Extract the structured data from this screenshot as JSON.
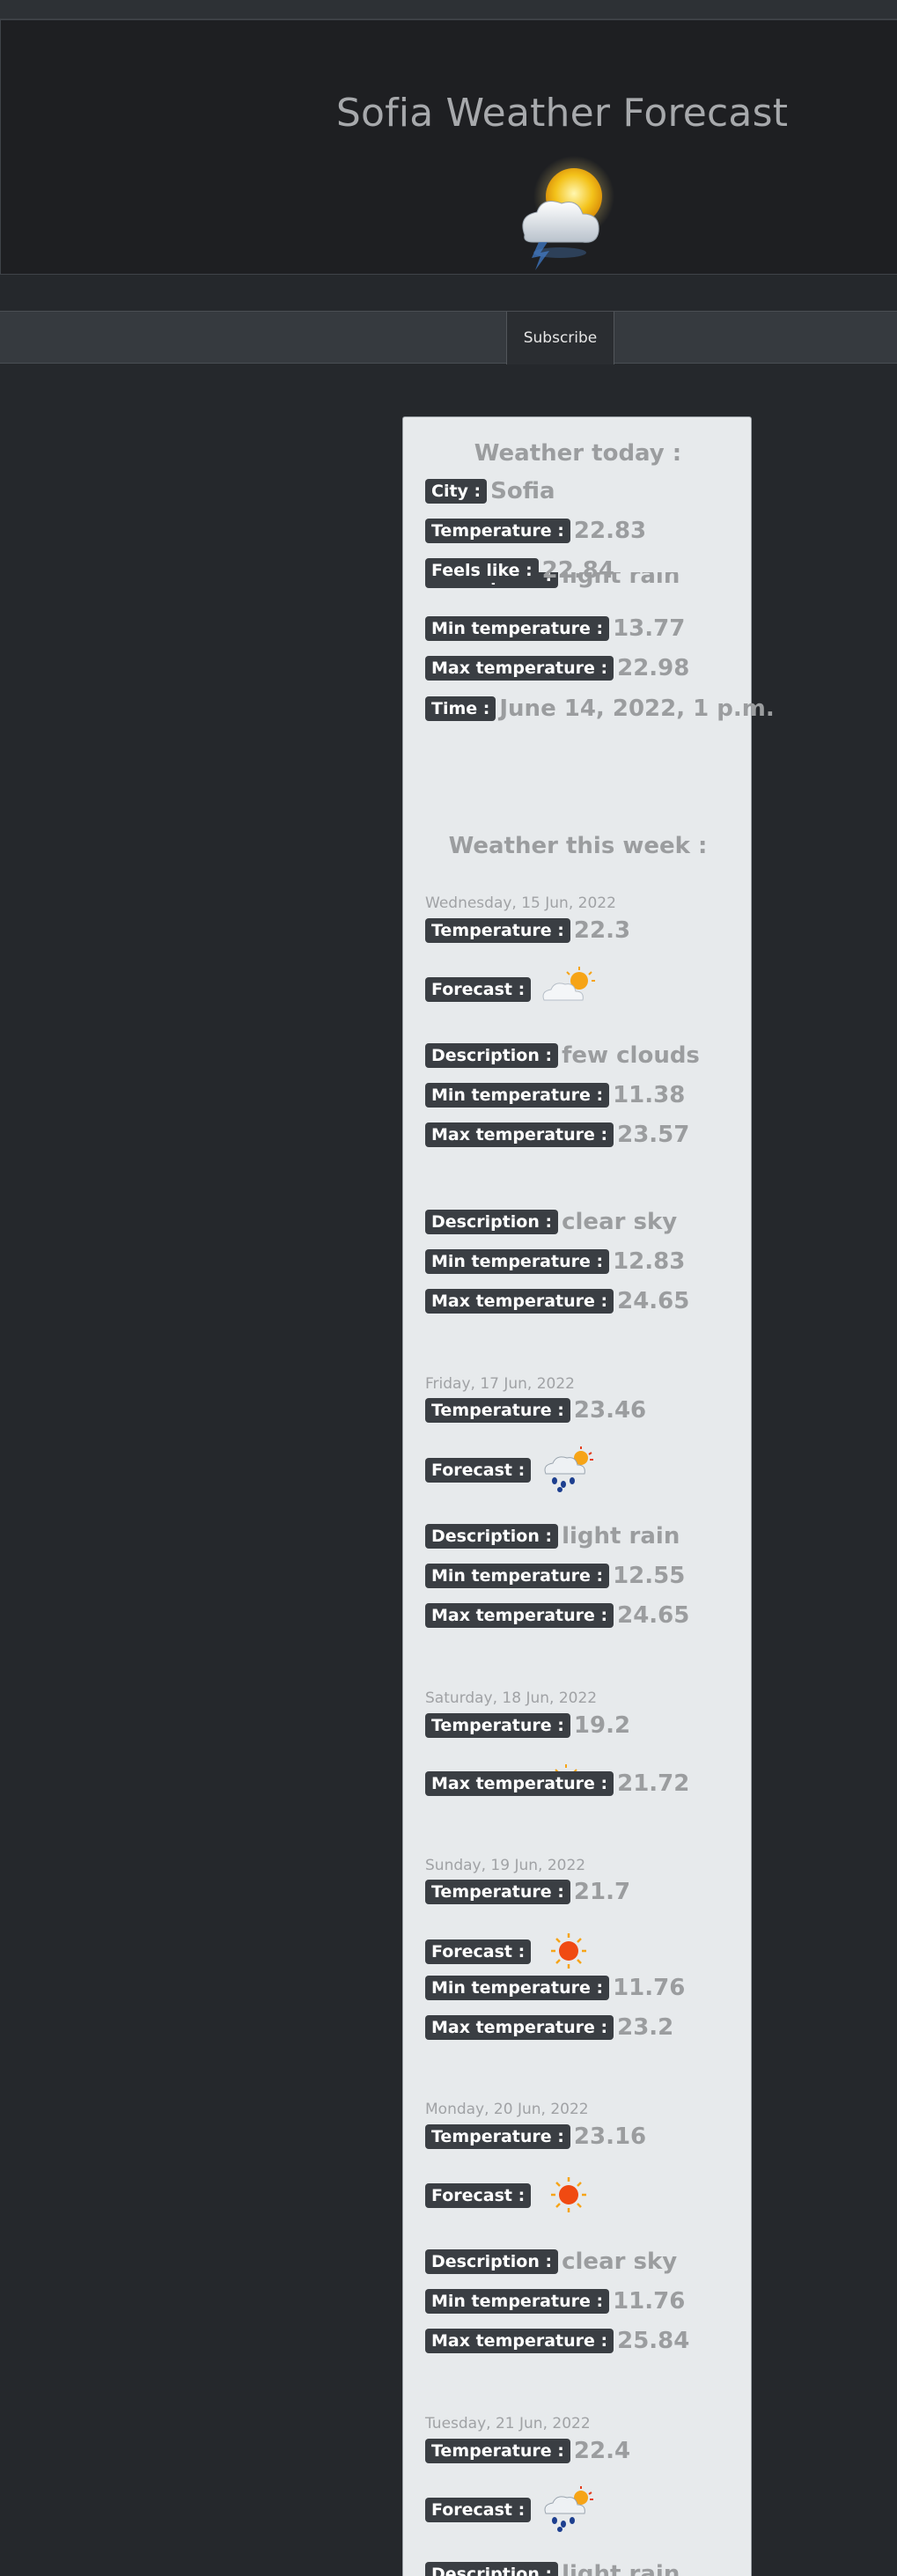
{
  "header": {
    "title": "Sofia Weather Forecast",
    "icon": "sun-behind-cloud-lightning-icon"
  },
  "toolbar": {
    "subscribe_label": "Subscribe"
  },
  "today": {
    "title": "Weather today :",
    "city_label": "City :",
    "city": "Sofia",
    "temp_label": "Temperature :",
    "temp": "22.83",
    "feels_label": "Feels like :",
    "feels": "22.84",
    "desc_label": "Description :",
    "desc": "light rain",
    "min_label": "Min temperature :",
    "min": "13.77",
    "max_label": "Max temperature :",
    "max": "22.98",
    "time_label": "Time :",
    "time": "June 14, 2022, 1 p.m."
  },
  "week": {
    "title": "Weather this week :",
    "labels": {
      "temp": "Temperature :",
      "forecast": "Forecast :",
      "desc": "Description :",
      "min": "Min temperature :",
      "max": "Max temperature :"
    },
    "days": [
      {
        "date": "Wednesday, 15 Jun, 2022",
        "temp": "22.3",
        "forecast_icon": "sun-behind-cloud-icon",
        "desc": "few clouds",
        "min": "11.38",
        "max": "23.57"
      },
      {
        "date": "",
        "desc": "clear sky",
        "min": "12.83",
        "max": "24.65"
      },
      {
        "date": "Friday, 17 Jun, 2022",
        "temp": "23.46",
        "forecast_icon": "rain-cloud-sun-icon",
        "desc": "light rain",
        "min": "12.55",
        "max": "24.65"
      },
      {
        "date": "Saturday, 18 Jun, 2022",
        "temp": "19.2",
        "forecast_icon": "sun-icon",
        "max": "21.72"
      },
      {
        "date": "Sunday, 19 Jun, 2022",
        "temp": "21.7",
        "forecast_icon": "sun-icon",
        "min": "11.76",
        "max": "23.2"
      },
      {
        "date": "Monday, 20 Jun, 2022",
        "temp": "23.16",
        "forecast_icon": "sun-icon",
        "desc": "clear sky",
        "min": "11.76",
        "max": "25.84"
      },
      {
        "date": "Tuesday, 21 Jun, 2022",
        "temp": "22.4",
        "forecast_icon": "rain-cloud-sun-icon",
        "desc": "light rain"
      }
    ]
  }
}
